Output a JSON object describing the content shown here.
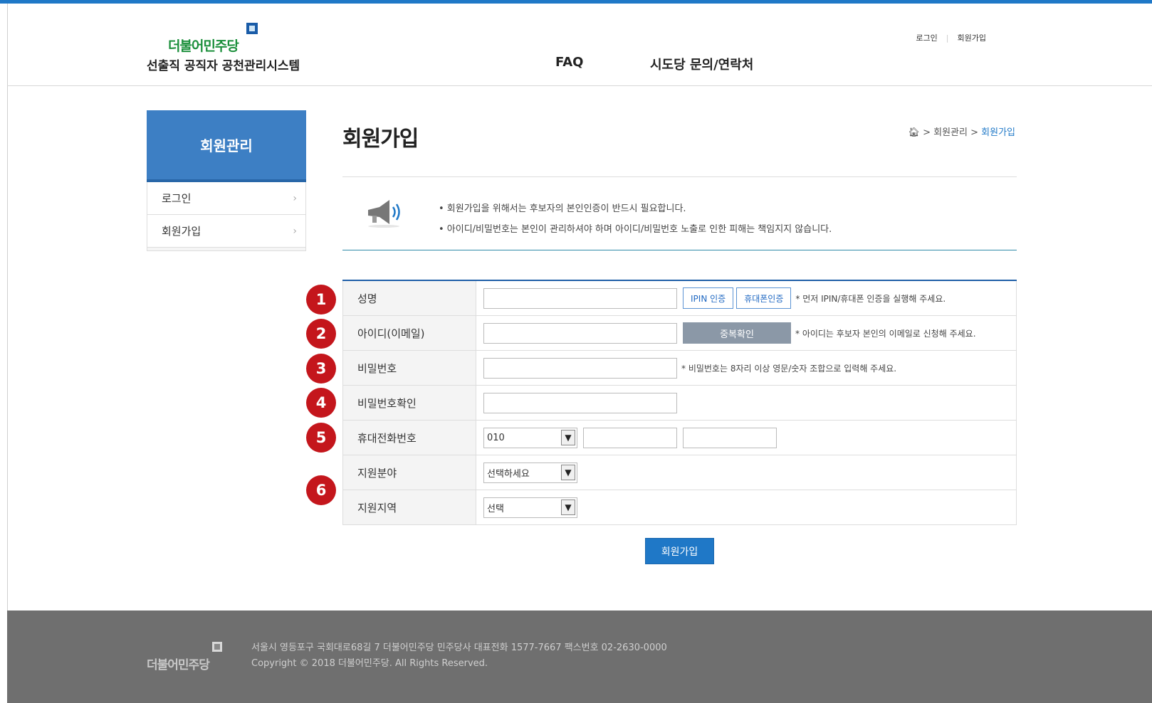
{
  "header": {
    "logo_text": "더불어민주당",
    "logo_sub": "선출직 공직자 공천관리시스템",
    "nav": [
      "FAQ",
      "시도당 문의/연락처"
    ],
    "util": {
      "login": "로그인",
      "join": "회원가입"
    }
  },
  "sidebar": {
    "title": "회원관리",
    "items": [
      {
        "label": "로그인"
      },
      {
        "label": "회원가입"
      }
    ]
  },
  "main": {
    "title": "회원가입",
    "breadcrumb": {
      "sep1": ">",
      "level1": "회원관리",
      "sep2": ">",
      "current": "회원가입"
    },
    "notice": [
      "• 회원가입을 위해서는 후보자의 본인인증이 반드시 필요합니다.",
      "• 아이디/비밀번호는 본인이 관리하셔야 하며 아이디/비밀번호 노출로 인한 피해는 책임지지 않습니다."
    ],
    "form": {
      "name": {
        "label": "성명",
        "btn_ipin": "IPIN 인증",
        "btn_phone": "휴대폰인증",
        "hint": "* 먼저 IPIN/휴대폰 인증을 실행해 주세요."
      },
      "id": {
        "label": "아이디(이메일)",
        "btn_check": "중복확인",
        "hint": "* 아이디는 후보자 본인의 이메일로 신청해 주세요."
      },
      "password": {
        "label": "비밀번호",
        "hint": "* 비밀번호는 8자리 이상 영문/숫자 조합으로 입력해 주세요."
      },
      "password_confirm": {
        "label": "비밀번호확인"
      },
      "mobile": {
        "label": "휴대전화번호",
        "prefix": "010"
      },
      "field": {
        "label": "지원분야",
        "selected": "선택하세요"
      },
      "region": {
        "label": "지원지역",
        "selected": "선택"
      }
    },
    "badges": [
      "1",
      "2",
      "3",
      "4",
      "5",
      "6"
    ],
    "submit_label": "회원가입"
  },
  "footer": {
    "logo_text": "더불어민주당",
    "address": "서울시 영등포구 국회대로68길 7 더불어민주당 민주당사 대표전화 1577-7667 팩스번호 02-2630-0000",
    "copyright": "Copyright © 2018 더불어민주당. All Rights Reserved."
  },
  "colors": {
    "primary": "#1f78c7",
    "sidebar": "#3d7fc4",
    "badge": "#c4161c",
    "footer": "#6f6f6f"
  },
  "icons": {
    "notice": "megaphone-icon",
    "home": "home-icon",
    "select": "chevron-down-icon"
  }
}
